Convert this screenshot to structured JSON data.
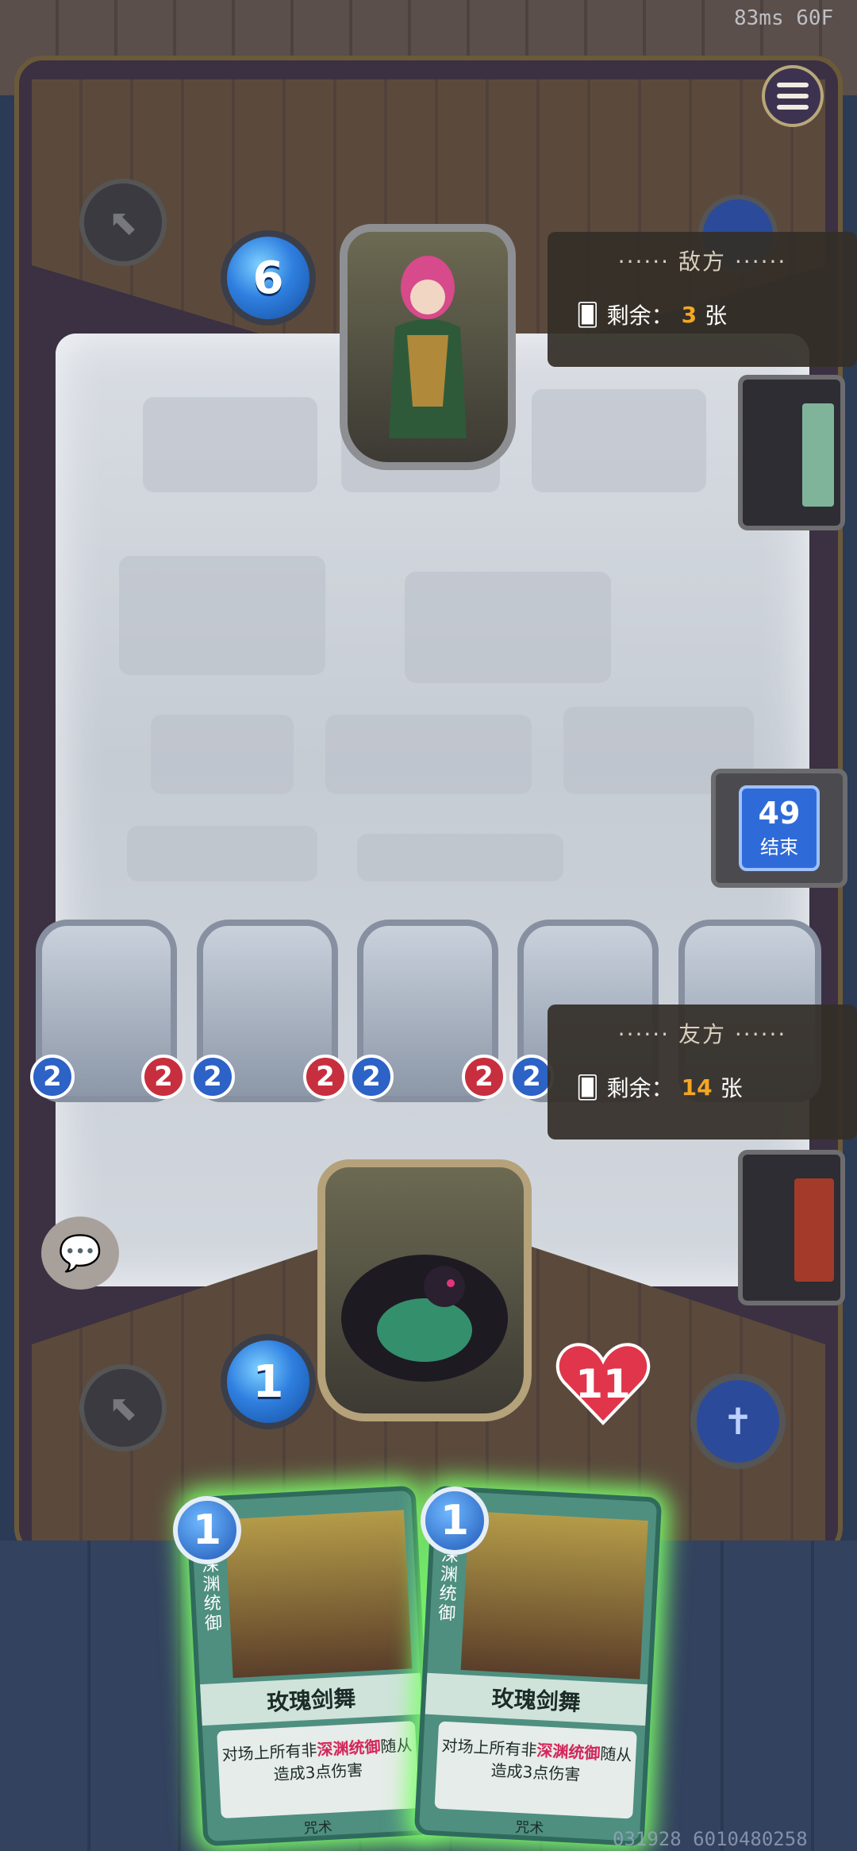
{
  "status_bar": {
    "fps_text": "83ms 60F"
  },
  "opponent": {
    "mana": "6",
    "panel": {
      "title": "敌方",
      "remaining_label": "剩余：",
      "remaining_count": "3",
      "remaining_unit": "张"
    }
  },
  "player": {
    "mana": "1",
    "health": "11",
    "panel": {
      "title": "友方",
      "remaining_label": "剩余：",
      "remaining_count": "14",
      "remaining_unit": "张"
    }
  },
  "end_turn": {
    "timer": "49",
    "label": "结束"
  },
  "board_minions": [
    {
      "attack": "2",
      "health": "2"
    },
    {
      "attack": "2",
      "health": "2"
    },
    {
      "attack": "2",
      "health": "2"
    },
    {
      "attack": "2",
      "health": ""
    },
    {
      "attack": "",
      "health": ""
    }
  ],
  "hand": [
    {
      "cost": "1",
      "tribe": "深渊统御",
      "name": "玫瑰剑舞",
      "text_pre": "对场上所有非",
      "text_kw": "深渊统御",
      "text_post": "随从造成3点伤害",
      "type": "咒术"
    },
    {
      "cost": "1",
      "tribe": "深渊统御",
      "name": "玫瑰剑舞",
      "text_pre": "对场上所有非",
      "text_kw": "深渊统御",
      "text_post": "随从造成3点伤害",
      "type": "咒术"
    }
  ],
  "footer": {
    "id_text": "031928 6010480258"
  }
}
